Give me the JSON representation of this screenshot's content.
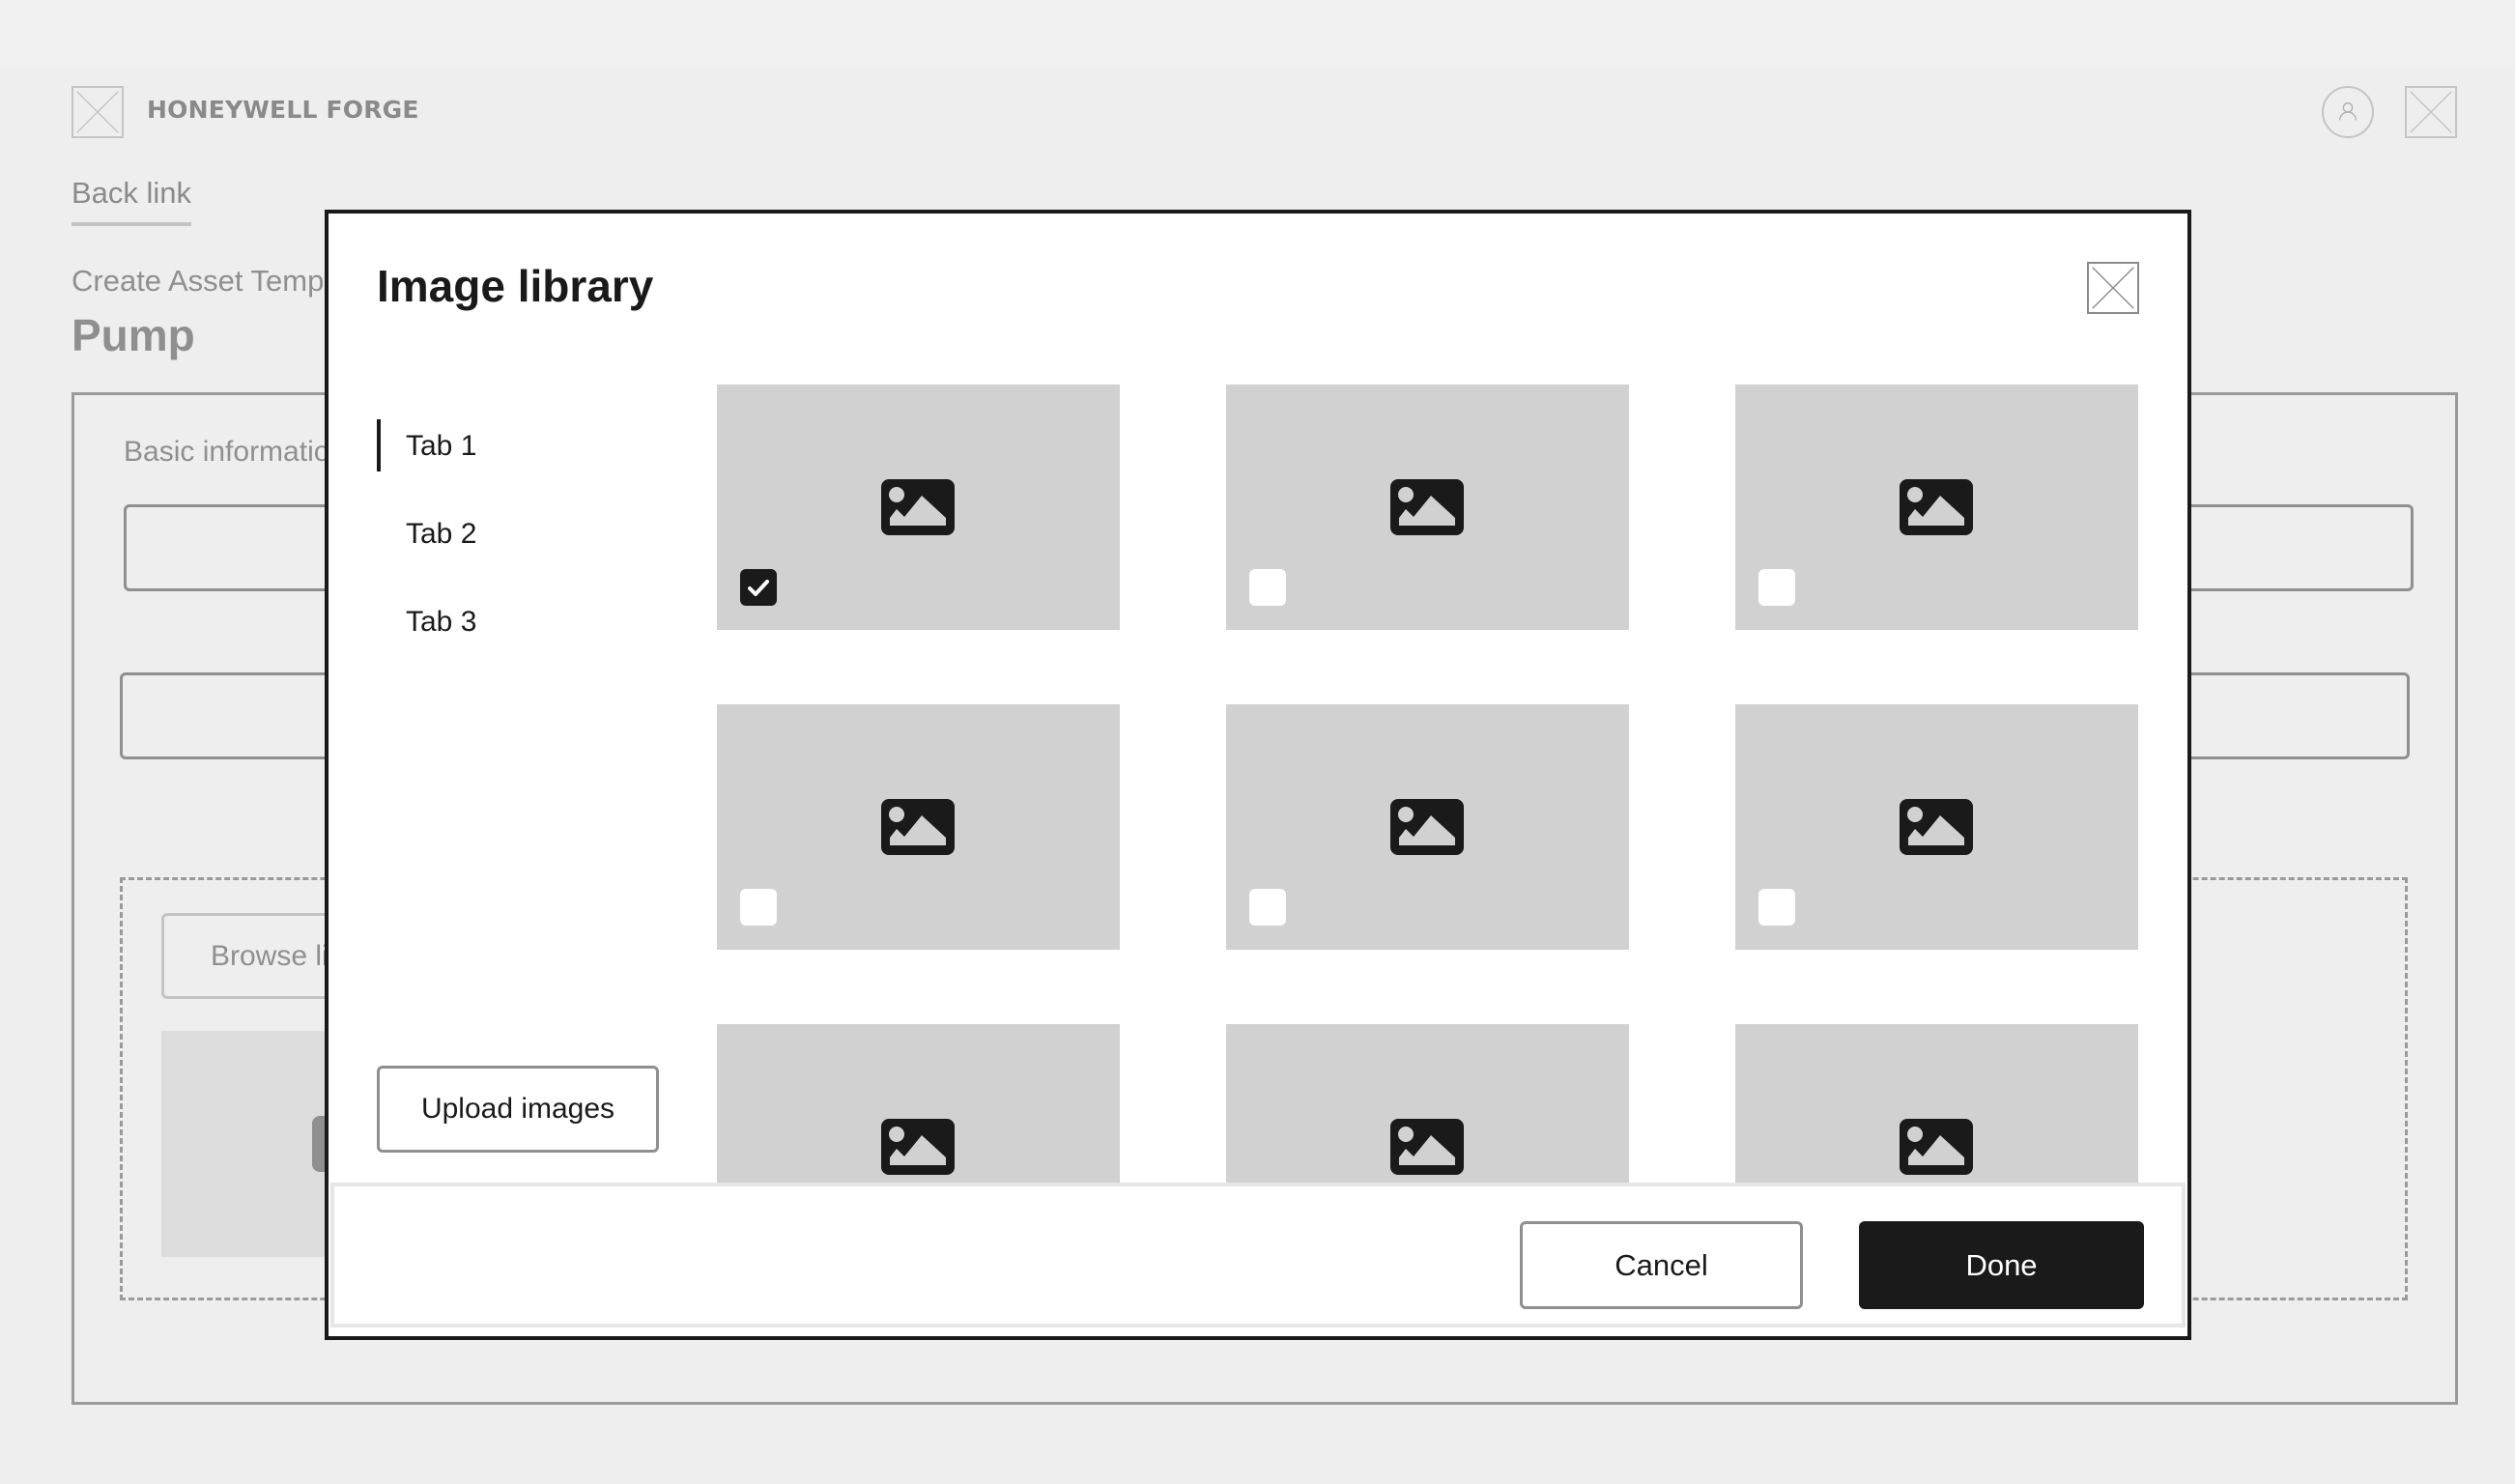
{
  "app": {
    "brand": "HONEYWELL FORGE",
    "back_link": "Back link",
    "breadcrumb": "Create Asset Template",
    "page_title": "Pump",
    "section_label": "Basic information",
    "browse_button": "Browse library"
  },
  "modal": {
    "title": "Image library",
    "close_icon": "close-x-placeholder",
    "tabs": [
      {
        "label": "Tab 1",
        "active": true
      },
      {
        "label": "Tab 2",
        "active": false
      },
      {
        "label": "Tab 3",
        "active": false
      }
    ],
    "upload_button": "Upload images",
    "images": [
      {
        "icon": "image-icon",
        "selected": true
      },
      {
        "icon": "image-icon",
        "selected": false
      },
      {
        "icon": "image-icon",
        "selected": false
      },
      {
        "icon": "image-icon",
        "selected": false
      },
      {
        "icon": "image-icon",
        "selected": false
      },
      {
        "icon": "image-icon",
        "selected": false
      },
      {
        "icon": "image-icon",
        "selected": false
      },
      {
        "icon": "image-icon",
        "selected": false
      },
      {
        "icon": "image-icon",
        "selected": false
      }
    ],
    "cancel_button": "Cancel",
    "done_button": "Done"
  },
  "colors": {
    "primary": "#1a1a1a",
    "card_bg": "#d1d1d1",
    "page_bg": "#eeeeee"
  }
}
